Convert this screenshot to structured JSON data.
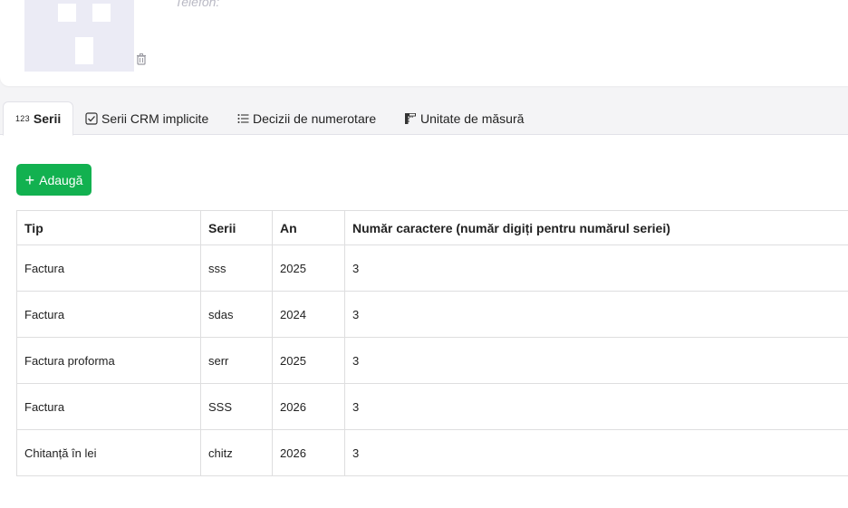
{
  "profile": {
    "phone_label": "Telefon:"
  },
  "tabs": [
    {
      "icon_text": "123",
      "icon": "numbers-icon",
      "label": "Serii",
      "active": true
    },
    {
      "icon": "checkbox-icon",
      "label": "Serii CRM implicite",
      "active": false
    },
    {
      "icon": "list-icon",
      "label": "Decizii de numerotare",
      "active": false
    },
    {
      "icon": "ruler-icon",
      "label": "Unitate de măsură",
      "active": false
    }
  ],
  "toolbar": {
    "add_label": "Adaugă"
  },
  "table": {
    "headers": [
      "Tip",
      "Serii",
      "An",
      "Număr caractere (număr digiți pentru numărul seriei)"
    ],
    "rows": [
      [
        "Factura",
        "sss",
        "2025",
        "3"
      ],
      [
        "Factura",
        "sdas",
        "2024",
        "3"
      ],
      [
        "Factura proforma",
        "serr",
        "2025",
        "3"
      ],
      [
        "Factura",
        "SSS",
        "2026",
        "3"
      ],
      [
        "Chitanță în lei",
        "chitz",
        "2026",
        "3"
      ]
    ]
  },
  "colors": {
    "accent": "#12b150",
    "placeholder": "#ebebf5"
  }
}
